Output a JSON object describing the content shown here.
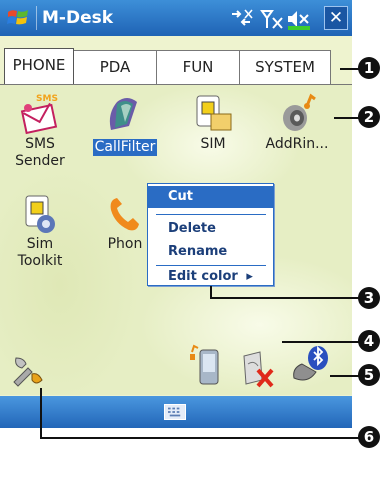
{
  "titlebar": {
    "title": "M-Desk",
    "close": "✕"
  },
  "tabs": [
    "PHONE",
    "PDA",
    "FUN",
    "SYSTEM"
  ],
  "apps": [
    {
      "label1": "SMS",
      "label2": "Sender",
      "icon": "sms-icon",
      "badge": "SMS"
    },
    {
      "label1": "CallFilter",
      "label2": "",
      "icon": "callfilter-icon"
    },
    {
      "label1": "SIM",
      "label2": "",
      "icon": "sim-icon"
    },
    {
      "label1": "AddRin...",
      "label2": "",
      "icon": "speaker-icon"
    },
    {
      "label1": "Sim",
      "label2": "Toolkit",
      "icon": "sim-toolkit-icon"
    },
    {
      "label1": "Phon",
      "label2": "",
      "icon": "phone-icon"
    }
  ],
  "context_menu": {
    "items": [
      "Cut",
      "Delete",
      "Rename",
      "Edit color"
    ],
    "submenu_arrow": "▸"
  },
  "callouts": [
    "1",
    "2",
    "3",
    "4",
    "5",
    "6"
  ],
  "colors": {
    "accent": "#2a6cc4",
    "titlebar": "#1f63b5",
    "desktop": "#e6eec4"
  }
}
